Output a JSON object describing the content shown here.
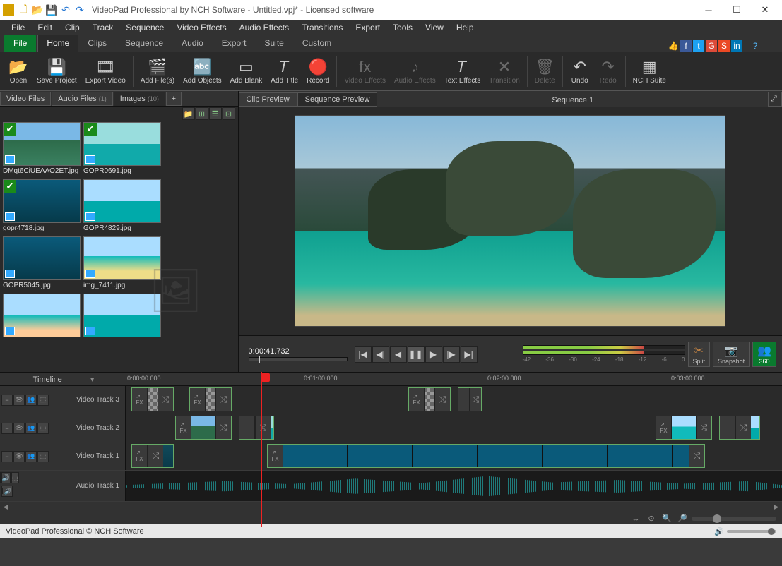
{
  "titlebar": {
    "title": "VideoPad Professional by NCH Software - Untitled.vpj* - Licensed software"
  },
  "menubar": [
    "File",
    "Edit",
    "Clip",
    "Track",
    "Sequence",
    "Video Effects",
    "Audio Effects",
    "Transitions",
    "Export",
    "Tools",
    "View",
    "Help"
  ],
  "ribbonTabs": {
    "file": "File",
    "items": [
      "Home",
      "Clips",
      "Sequence",
      "Audio",
      "Export",
      "Suite",
      "Custom"
    ],
    "active": "Home"
  },
  "ribbon": [
    {
      "label": "Open",
      "icon": "📂",
      "enabled": true
    },
    {
      "label": "Save Project",
      "icon": "💾",
      "enabled": true
    },
    {
      "label": "Export Video",
      "icon": "🎞",
      "enabled": true
    },
    {
      "sep": true
    },
    {
      "label": "Add File(s)",
      "icon": "🎬",
      "enabled": true
    },
    {
      "label": "Add Objects",
      "icon": "🔤",
      "enabled": true
    },
    {
      "label": "Add Blank",
      "icon": "▭",
      "enabled": true
    },
    {
      "label": "Add Title",
      "icon": "𝑇",
      "enabled": true
    },
    {
      "label": "Record",
      "icon": "🔴",
      "enabled": true
    },
    {
      "sep": true
    },
    {
      "label": "Video Effects",
      "icon": "fx",
      "enabled": false
    },
    {
      "label": "Audio Effects",
      "icon": "♪",
      "enabled": false
    },
    {
      "label": "Text Effects",
      "icon": "𝑇",
      "enabled": true
    },
    {
      "label": "Transition",
      "icon": "✕",
      "enabled": false
    },
    {
      "sep": true
    },
    {
      "label": "Delete",
      "icon": "🗑",
      "enabled": false
    },
    {
      "sep": true
    },
    {
      "label": "Undo",
      "icon": "↶",
      "enabled": true
    },
    {
      "label": "Redo",
      "icon": "↷",
      "enabled": false
    },
    {
      "sep": true
    },
    {
      "label": "NCH Suite",
      "icon": "▦",
      "enabled": true
    }
  ],
  "mediaTabs": [
    {
      "label": "Video Files",
      "count": ""
    },
    {
      "label": "Audio Files",
      "count": "(1)"
    },
    {
      "label": "Images",
      "count": "(10)",
      "active": true
    }
  ],
  "thumbs": [
    {
      "name": "DMqt6CiUEAAO2ET.jpg",
      "cls": "sky1",
      "check": true
    },
    {
      "name": "GOPR0691.jpg",
      "cls": "sky2",
      "check": true
    },
    {
      "name": "gopr4718.jpg",
      "cls": "water",
      "check": true
    },
    {
      "name": "GOPR4829.jpg",
      "cls": "person",
      "check": false
    },
    {
      "name": "GOPR5045.jpg",
      "cls": "water",
      "check": false
    },
    {
      "name": "img_7411.jpg",
      "cls": "boat",
      "check": false
    },
    {
      "name": "",
      "cls": "beach",
      "check": false
    },
    {
      "name": "",
      "cls": "person",
      "check": false
    }
  ],
  "preview": {
    "tabs": [
      "Clip Preview",
      "Sequence Preview"
    ],
    "activeTab": "Sequence Preview",
    "sequenceName": "Sequence 1",
    "timecode": "0:00:41.732",
    "meterLabels": [
      "-42",
      "-36",
      "-30",
      "-24",
      "-18",
      "-12",
      "-6",
      "0"
    ],
    "splitLabel": "Split",
    "snapshotLabel": "Snapshot",
    "label360": "360"
  },
  "timeline": {
    "header": "Timeline",
    "ticks": [
      {
        "label": "0:00:00.000",
        "pos": 0
      },
      {
        "label": "0:01:00.000",
        "pos": 250
      },
      {
        "label": "0:02:00.000",
        "pos": 510
      },
      {
        "label": "0:03:00.000",
        "pos": 770
      }
    ],
    "tracks": [
      {
        "name": "Video Track 3"
      },
      {
        "name": "Video Track 2"
      },
      {
        "name": "Video Track 1"
      },
      {
        "name": "Audio Track 1"
      }
    ]
  },
  "statusbar": {
    "text": "VideoPad Professional © NCH Software"
  }
}
